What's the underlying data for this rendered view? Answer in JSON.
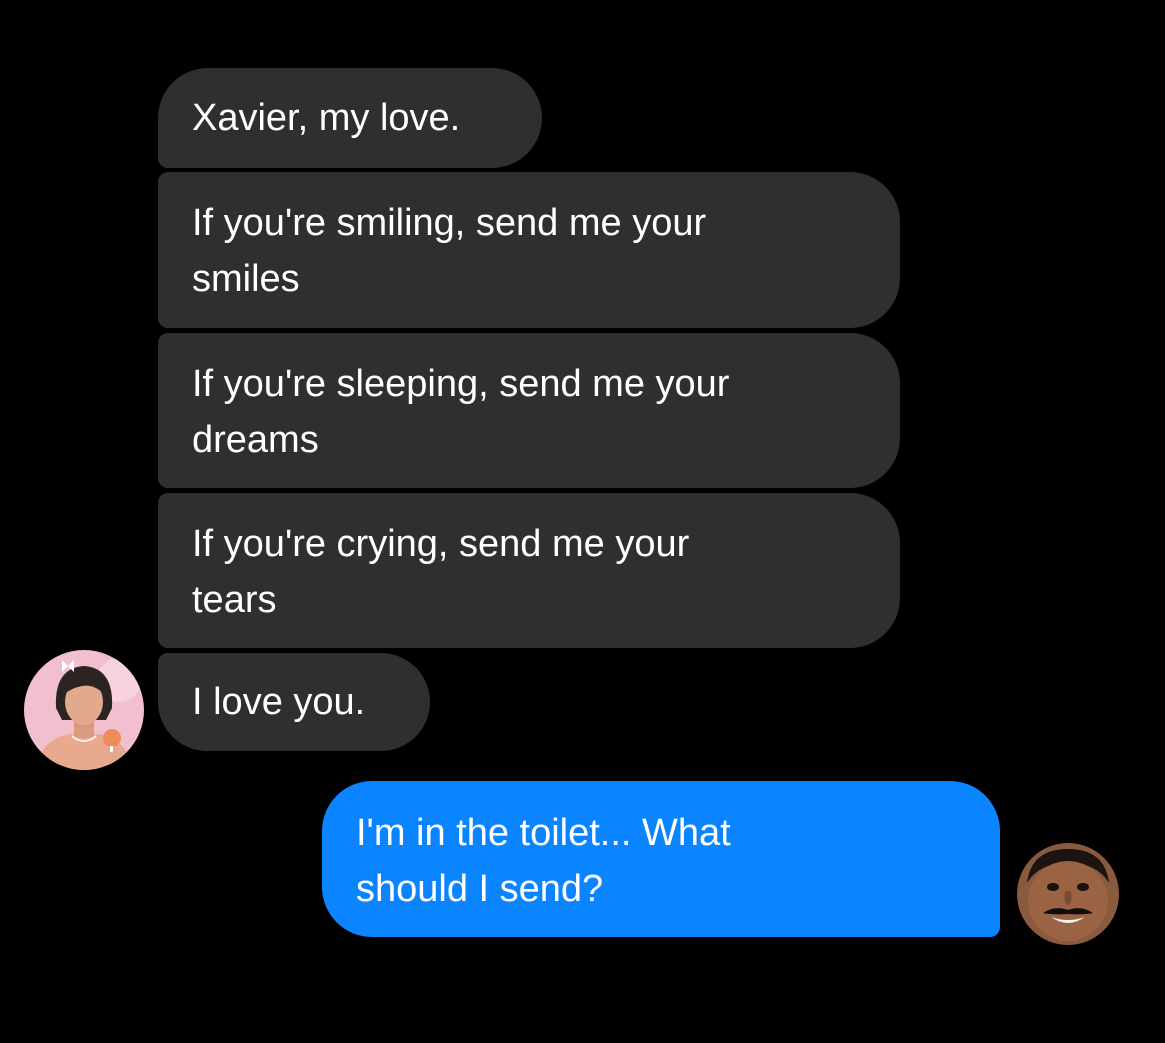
{
  "conversation": {
    "incoming": [
      {
        "lines": [
          "Xavier, my love."
        ]
      },
      {
        "lines": [
          "If you're smiling, send me your",
          "smiles"
        ]
      },
      {
        "lines": [
          "If you're sleeping, send me your",
          "dreams"
        ]
      },
      {
        "lines": [
          "If you're crying, send me your",
          "tears"
        ]
      },
      {
        "lines": [
          "I love you."
        ]
      }
    ],
    "outgoing": [
      {
        "lines": [
          "I'm in the toilet... What",
          "should I send?"
        ]
      }
    ]
  },
  "colors": {
    "background": "#000000",
    "incoming_bubble": "#2f2f2f",
    "outgoing_bubble": "#0a84ff",
    "text": "#ffffff"
  },
  "icons": {
    "sender_avatar": "woman-pink-background-avatar",
    "user_avatar": "smiling-man-avatar"
  }
}
